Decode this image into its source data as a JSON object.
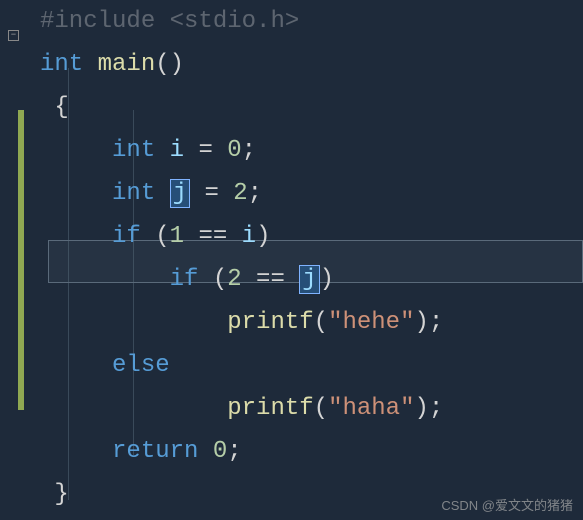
{
  "code": {
    "include": "#include <stdio.h>",
    "main_sig": {
      "type": "int",
      "name": "main",
      "parens": "()"
    },
    "open_brace": "{",
    "decl_i": {
      "type": "int",
      "var": "i",
      "eq": " = ",
      "val": "0",
      "semi": ";"
    },
    "decl_j": {
      "type": "int",
      "var": "j",
      "eq": " = ",
      "val": "2",
      "semi": ";"
    },
    "if1": {
      "kw": "if",
      "open": " (",
      "lhs": "1",
      "op": " == ",
      "rhs": "i",
      "close": ")"
    },
    "if2": {
      "kw": "if",
      "open": " (",
      "lhs": "2",
      "op": " == ",
      "rhs": "j",
      "close": ")"
    },
    "print1": {
      "fn": "printf",
      "open": "(",
      "str": "\"hehe\"",
      "close": ")",
      "semi": ";"
    },
    "else_kw": "else",
    "print2": {
      "fn": "printf",
      "open": "(",
      "str": "\"haha\"",
      "close": ")",
      "semi": ";"
    },
    "return_stmt": {
      "kw": "return",
      "val": " 0",
      "semi": ";"
    },
    "close_brace": "}"
  },
  "fold_symbol": "−",
  "watermark": "CSDN @爱文文的猪猪"
}
